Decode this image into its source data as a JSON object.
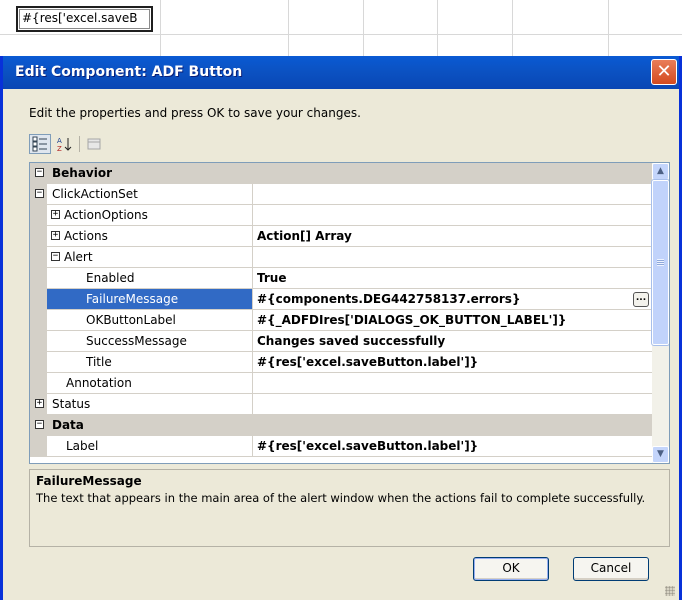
{
  "background": {
    "button_cell_text": "#{res['excel.saveB"
  },
  "dialog": {
    "title": "Edit Component: ADF Button",
    "close_glyph": "✕",
    "instruction": "Edit the properties and press OK to save your changes.",
    "toolbar": {
      "categorized": "categorized-icon",
      "alphabetical": "alphabetical-icon",
      "property_pages": "property-pages-icon"
    },
    "grid": {
      "ellipsis": "...",
      "rows": [
        {
          "name": "Behavior",
          "value": "",
          "category": true,
          "expander": "−"
        },
        {
          "name": "ClickActionSet",
          "value": "",
          "expander": "−"
        },
        {
          "name": "ActionOptions",
          "value": "",
          "expander": "+"
        },
        {
          "name": "Actions",
          "value": "Action[] Array",
          "expander": "+"
        },
        {
          "name": "Alert",
          "value": "",
          "expander": "−"
        },
        {
          "name": "Enabled",
          "value": "True"
        },
        {
          "name": "FailureMessage",
          "value": "#{components.DEG442758137.errors}",
          "selected": true
        },
        {
          "name": "OKButtonLabel",
          "value": "#{_ADFDIres['DIALOGS_OK_BUTTON_LABEL']}"
        },
        {
          "name": "SuccessMessage",
          "value": "Changes saved successfully"
        },
        {
          "name": "Title",
          "value": "#{res['excel.saveButton.label']}"
        },
        {
          "name": "Annotation",
          "value": ""
        },
        {
          "name": "Status",
          "value": "",
          "expander": "+"
        },
        {
          "name": "Data",
          "value": "",
          "category": true,
          "expander": "−"
        },
        {
          "name": "Label",
          "value": "#{res['excel.saveButton.label']}"
        }
      ]
    },
    "description": {
      "title": "FailureMessage",
      "text": "The text that appears in the main area of the alert window when the actions fail to complete successfully."
    },
    "buttons": {
      "ok": "OK",
      "cancel": "Cancel"
    },
    "colors": {
      "title_bar": "#0a5ad4",
      "selection": "#316ac5",
      "dialog_face": "#ece9d8"
    }
  }
}
